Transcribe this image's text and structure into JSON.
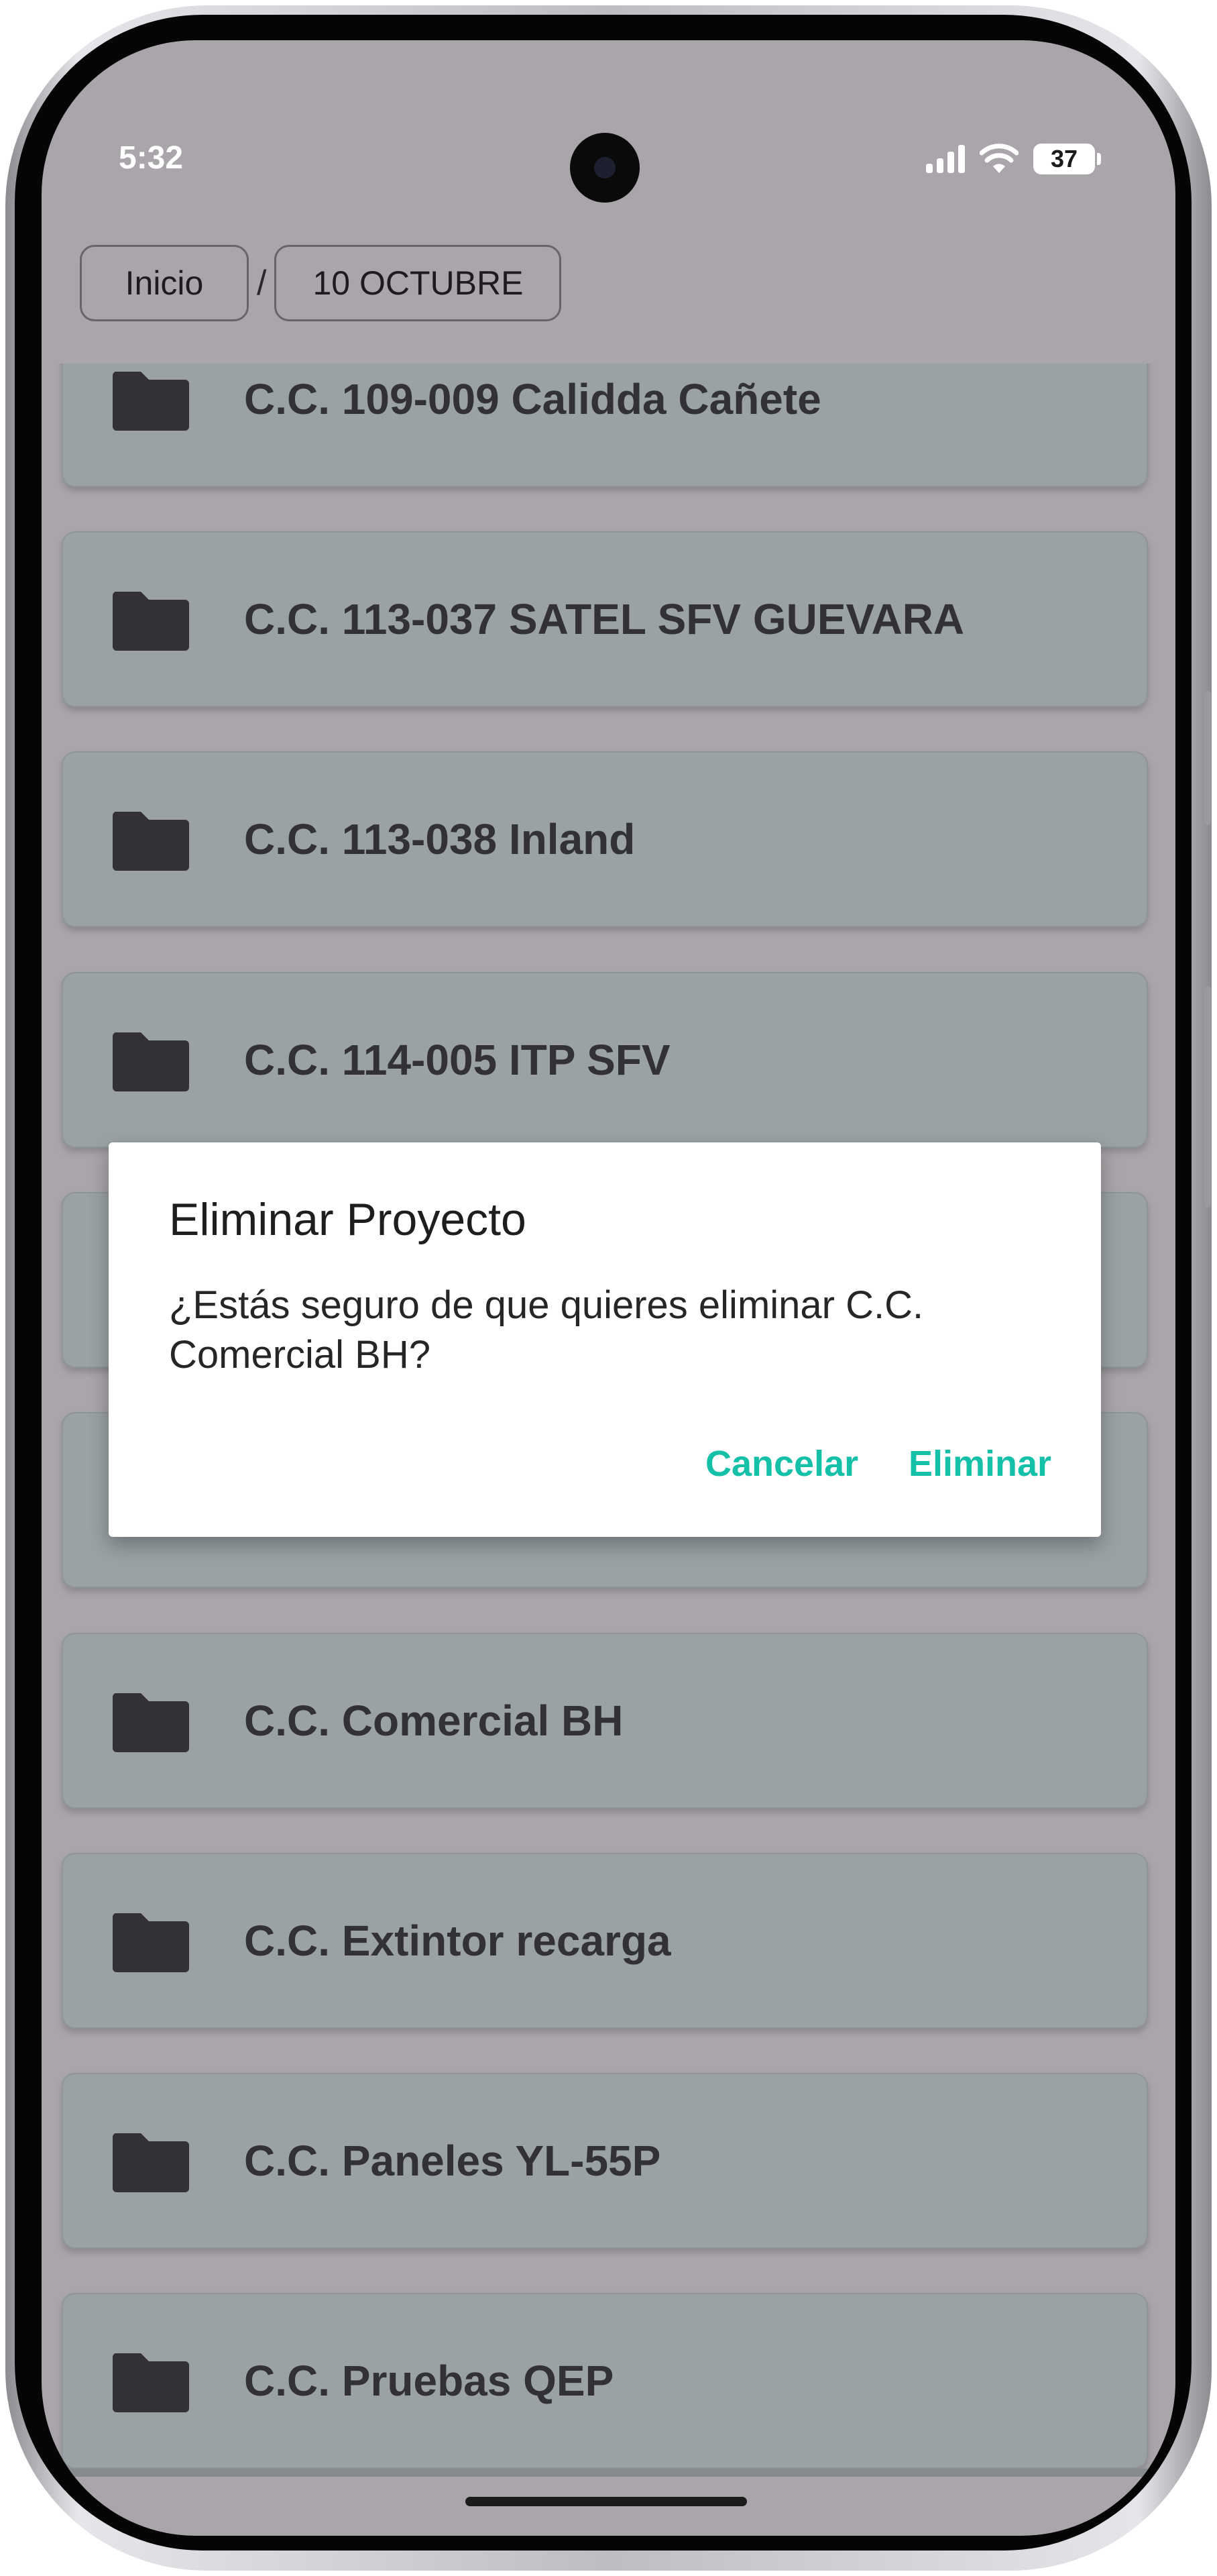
{
  "status_bar": {
    "time": "5:32",
    "battery": "37"
  },
  "breadcrumb": {
    "items": [
      "Inicio",
      "10 OCTUBRE"
    ],
    "separator": "/"
  },
  "folders": [
    "C.C. 109-009 Calidda Cañete",
    "C.C. 113-037 SATEL SFV GUEVARA",
    "C.C. 113-038 Inland",
    "C.C. 114-005 ITP SFV",
    "",
    "",
    "C.C. Comercial BH",
    "C.C. Extintor recarga",
    "C.C. Paneles YL-55P",
    "C.C. Pruebas QEP"
  ],
  "dialog": {
    "title": "Eliminar Proyecto",
    "message": "¿Estás seguro de que quieres eliminar C.C. Comercial BH?",
    "cancel_label": "Cancelar",
    "confirm_label": "Eliminar"
  },
  "colors": {
    "accent": "#14c0a8",
    "card": "#9aa2a6",
    "scrim_background": "#a9a5aa"
  },
  "icons": {
    "folder": "folder-icon"
  }
}
